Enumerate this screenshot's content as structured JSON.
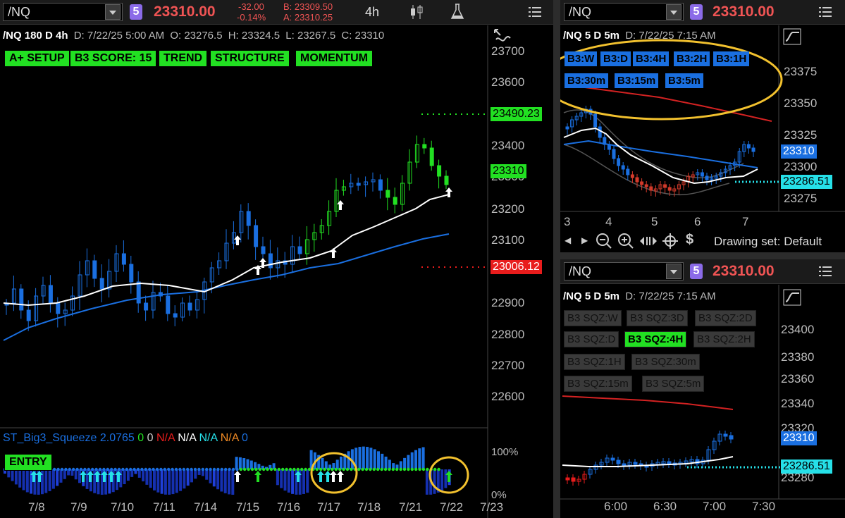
{
  "main": {
    "symbol": "/NQ",
    "badge": "5",
    "price": "23310.00",
    "change": "-32.00",
    "change_pct": "-0.14%",
    "bid": "B: 23309.50",
    "ask": "A: 23310.25",
    "timeframe": "4h",
    "info": {
      "title": "/NQ 180 D 4h",
      "date": "D: 7/22/25 5:00 AM",
      "open": "O: 23276.5",
      "high": "H: 23324.5",
      "low": "L: 23267.5",
      "close": "C: 23310"
    },
    "buttons": [
      "A+ SETUP",
      "B3 SCORE: 15",
      "TREND",
      "STRUCTURE",
      "MOMENTUM"
    ],
    "yaxis": [
      "23700",
      "23600",
      "23400",
      "23300",
      "23200",
      "23100",
      "22900",
      "22800",
      "22700",
      "22600"
    ],
    "tags": {
      "upper": "23490.23",
      "current": "23310",
      "lower": "23006.12"
    },
    "xaxis": [
      "7/8",
      "7/9",
      "7/10",
      "7/11",
      "7/14",
      "7/15",
      "7/16",
      "7/17",
      "7/18",
      "7/21",
      "7/22",
      "7/23"
    ],
    "study": {
      "name": "ST_Big3_Squeeze",
      "values": [
        "2.0765",
        "0",
        "0",
        "N/A",
        "N/A",
        "N/A",
        "N/A",
        "0"
      ],
      "entry": "ENTRY",
      "yaxis": [
        "100%",
        "0%"
      ]
    }
  },
  "tr": {
    "symbol": "/NQ",
    "badge": "5",
    "price": "23310.00",
    "info": {
      "title": "/NQ 5 D 5m",
      "date": "D: 7/22/25 7:15 AM"
    },
    "buttons_row1": [
      "B3:W",
      "B3:D",
      "B3:4H",
      "B3:2H",
      "B3:1H"
    ],
    "buttons_row2": [
      "B3:30m",
      "B3:15m",
      "B3:5m"
    ],
    "yaxis": [
      "23375",
      "23350",
      "23325",
      "23300",
      "23275"
    ],
    "tags": {
      "current": "23310",
      "level": "23286.51"
    },
    "xaxis": [
      "3",
      "4",
      "5",
      "6",
      "7"
    ],
    "drawing_set": "Drawing set: Default"
  },
  "br": {
    "symbol": "/NQ",
    "badge": "5",
    "price": "23310.00",
    "info": {
      "title": "/NQ 5 D 5m",
      "date": "D: 7/22/25 7:15 AM"
    },
    "sqz_rows": [
      [
        "B3 SQZ:W",
        "B3 SQZ:3D",
        "B3 SQZ:2D"
      ],
      [
        "B3 SQZ:D",
        "B3 SQZ:4H",
        "B3 SQZ:2H"
      ],
      [
        "B3 SQZ:1H",
        "B3 SQZ:30m"
      ],
      [
        "B3 SQZ:15m",
        "B3 SQZ:5m"
      ]
    ],
    "yaxis": [
      "23400",
      "23380",
      "23360",
      "23340",
      "23320",
      "23280"
    ],
    "tags": {
      "current": "23310",
      "level": "23286.51"
    },
    "xaxis": [
      "6:00",
      "6:30",
      "7:00",
      "7:30"
    ]
  },
  "colors": {
    "green": "#22e022",
    "red": "#e81c1c",
    "blue": "#1a6fe0",
    "cyan": "#26e0e8",
    "highlight": "#f2c12e"
  }
}
